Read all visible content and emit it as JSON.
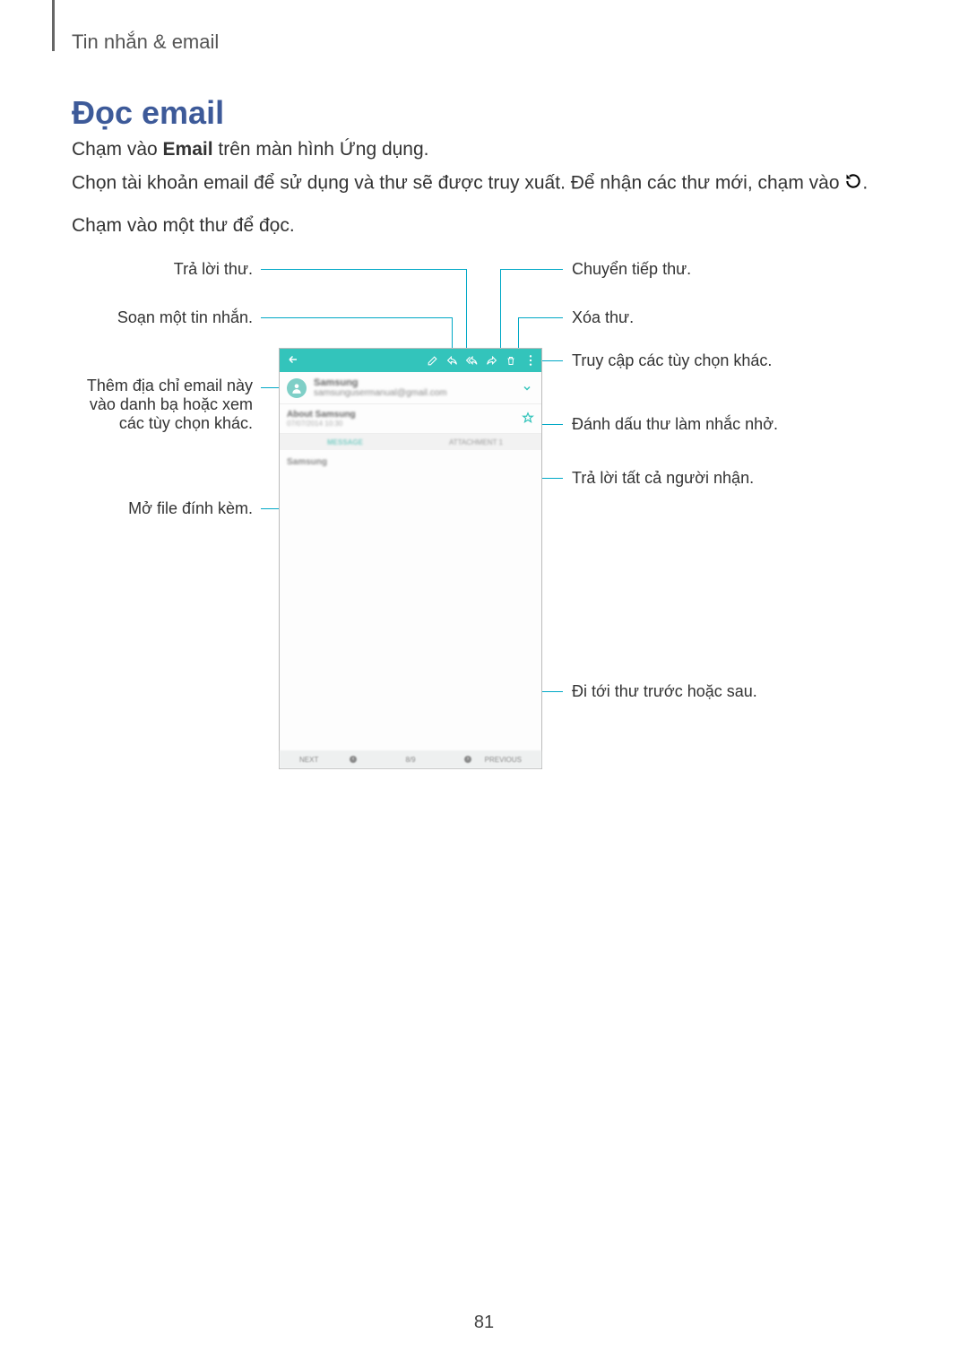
{
  "chapter": "Tin nhắn & email",
  "heading": "Đọc email",
  "para1_pre": "Chạm vào ",
  "para1_b": "Email",
  "para1_post": " trên màn hình Ứng dụng.",
  "para2_pre": "Chọn tài khoản email để sử dụng và thư sẽ được truy xuất. Để nhận các thư mới, chạm vào ",
  "para2_post": ".",
  "para3": "Chạm vào một thư để đọc.",
  "ann_left_reply": "Trả lời thư.",
  "ann_left_compose": "Soạn một tin nhắn.",
  "ann_left_addcontact": "Thêm địa chỉ email này vào danh bạ hoặc xem các tùy chọn khác.",
  "ann_left_attachment": "Mở file đính kèm.",
  "ann_right_forward": "Chuyển tiếp thư.",
  "ann_right_delete": "Xóa thư.",
  "ann_right_more": "Truy cập các tùy chọn khác.",
  "ann_right_reminder": "Đánh dấu thư làm nhắc nhở.",
  "ann_right_replyall": "Trả lời tất cả người nhận.",
  "ann_right_nav": "Đi tới thư trước hoặc sau.",
  "phone": {
    "sender_name": "Samsung",
    "sender_addr": "samsungusermanual@gmail.com",
    "subject": "About Samsung",
    "date": "07/07/2014 10:30",
    "tab_message": "MESSAGE",
    "tab_attachment": "ATTACHMENT 1",
    "body_sender": "Samsung",
    "footer_next": "NEXT",
    "footer_count": "8/9",
    "footer_prev": "PREVIOUS"
  },
  "page_number": "81"
}
